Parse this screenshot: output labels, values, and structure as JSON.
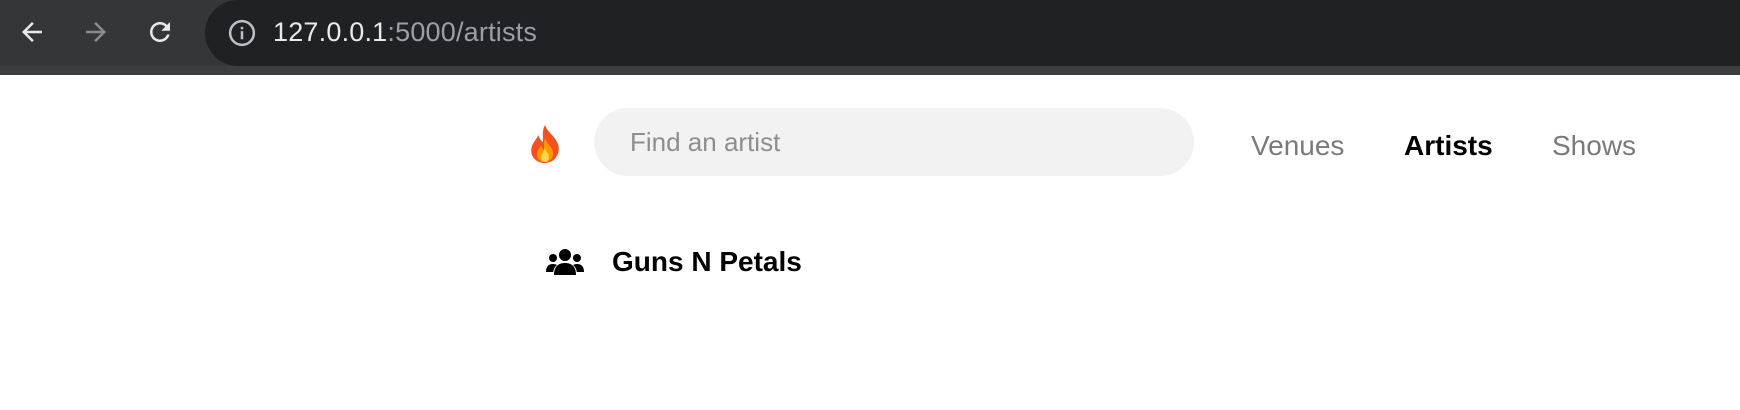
{
  "browser": {
    "url_host": "127.0.0.1",
    "url_path": ":5000/artists",
    "icons": {
      "back": "arrow-left-icon",
      "forward": "arrow-right-icon",
      "reload": "reload-icon",
      "site_info": "info-icon"
    }
  },
  "header": {
    "logo_icon": "fire-icon",
    "search": {
      "placeholder": "Find an artist",
      "value": ""
    },
    "nav": {
      "venues": "Venues",
      "artists": "Artists",
      "shows": "Shows",
      "active": "Artists"
    }
  },
  "artists": [
    {
      "name": "Guns N Petals",
      "icon": "users-icon"
    }
  ],
  "colors": {
    "chrome_bg": "#35363a",
    "omnibox_bg": "#202124",
    "search_bg": "#f2f2f2",
    "nav_inactive": "#7a7a7a",
    "nav_active": "#000000"
  }
}
